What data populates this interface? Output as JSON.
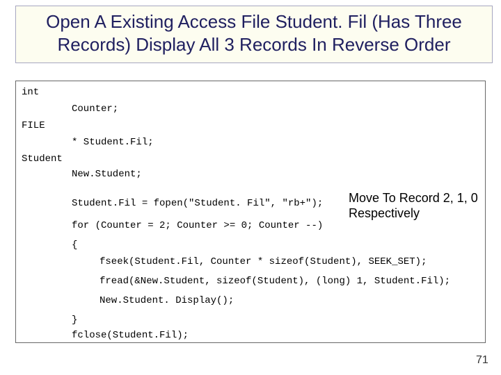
{
  "title": {
    "line1": "Open A Existing Access File Student. Fil (Has Three",
    "line2": "Records) Display All 3 Records In Reverse Order"
  },
  "code": {
    "l1": "int",
    "l2": "Counter;",
    "l3": "FILE",
    "l4": "* Student.Fil;",
    "l5": "Student",
    "l6": "New.Student;",
    "l7": "Student.Fil = fopen(\"Student. Fil\", \"rb+\");",
    "l8": "for (Counter = 2; Counter >= 0; Counter --)",
    "l9": "{",
    "l10": "fseek(Student.Fil, Counter * sizeof(Student), SEEK_SET);",
    "l11": "fread(&New.Student, sizeof(Student), (long) 1, Student.Fil);",
    "l12": "New.Student. Display();",
    "l13": "}",
    "l14": "fclose(Student.Fil);"
  },
  "annotation": {
    "line1": "Move To Record 2, 1, 0",
    "line2": "Respectively"
  },
  "page_number": "71"
}
